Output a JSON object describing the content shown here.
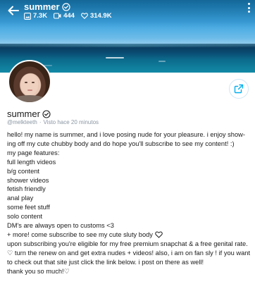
{
  "header": {
    "username": "summer",
    "stats": [
      {
        "icon": "image-icon",
        "value": "7.3K"
      },
      {
        "icon": "video-icon",
        "value": "444"
      },
      {
        "icon": "heart-icon",
        "value": "314.9K"
      }
    ]
  },
  "profile": {
    "name": "summer",
    "handle": "@melkteeth",
    "separator": "·",
    "last_seen": "Visto hace 20 minutos"
  },
  "bio": [
    "hello! my name is summer, and i love posing nude for your pleasure. i enjoy show-ing off my cute chubby body and do hope you'll subscribe to see my content! :)",
    "my page features:",
    "full length videos",
    "b/g content",
    "shower videos",
    "fetish friendly",
    "anal play",
    "some feet stuff",
    "solo content",
    "DM's are always open to customs <3",
    "+ more! come subscribe to see my cute sluty body",
    "upon subscribing you're eligible for my free premium snapchat & a free genital rate. ♡ turn the renew on and get extra nudes + videos! also, i am on fan sly ! if you want to check out that site just click the link below. i post on there as well!",
    "thank you so much!♡"
  ],
  "colors": {
    "accent": "#00aff0",
    "muted": "#8a96a3",
    "text": "#1b1b1b"
  }
}
